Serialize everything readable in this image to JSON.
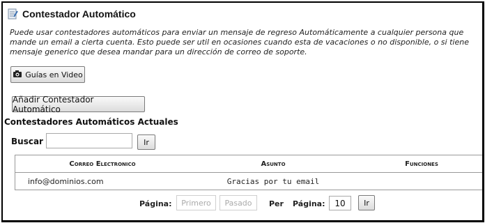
{
  "header": {
    "title": "Contestador Automático",
    "icon": "note-icon"
  },
  "description": "Puede usar contestadores automáticos para enviar un mensaje de regreso Automáticamente a cualquier persona que\nmande un email a cierta cuenta. Esto puede ser util en ocasiones cuando esta de vacaciones o no disponible, o si tiene\nmensaje generico que desea mandar para un dirección de correo de soporte.",
  "buttons": {
    "video_guides": "Guías en Video",
    "add_autoresponder": "Añadir Contestador Automático",
    "go": "Ir"
  },
  "section_title": "Contestadores Automáticos Actuales",
  "search": {
    "label": "Buscar",
    "value": ""
  },
  "table": {
    "headers": [
      "Correo Electronico",
      "Asunto",
      "Funciones"
    ],
    "rows": [
      {
        "email": "info@dominios.com",
        "subject": "Gracias por tu email",
        "functions": ""
      }
    ]
  },
  "pagination": {
    "page_label": "Página:",
    "first": "Primero",
    "previous": "Pasado",
    "per_label": "Per",
    "page_label_2": "Página:",
    "per_page_value": "10",
    "go": "Ir"
  },
  "colors": {
    "border": "#000000",
    "button_bg": "#dcdcdc",
    "disabled_text": "#aaaaaa"
  }
}
